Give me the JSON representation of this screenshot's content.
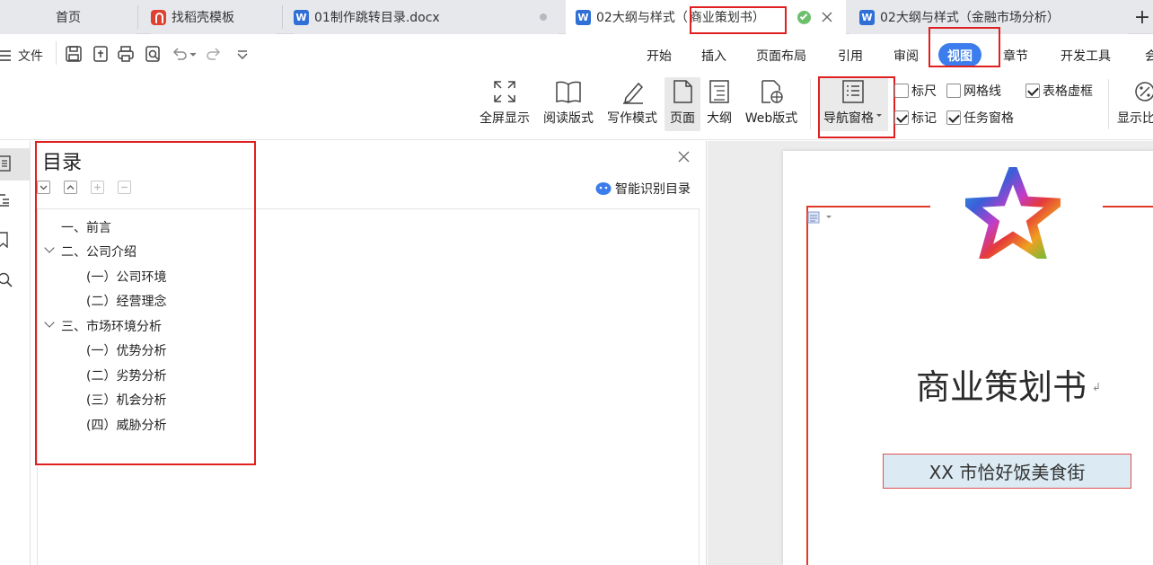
{
  "tabs": [
    {
      "label": "首页",
      "active": false
    },
    {
      "label": "找稻壳模板",
      "active": false,
      "icon": "docer-icon"
    },
    {
      "label": "01制作跳转目录.docx",
      "active": false,
      "icon": "wps-writer-icon"
    },
    {
      "label": "02大纲与样式（",
      "label_box": "商业策划书）",
      "active": true,
      "icon": "wps-writer-icon"
    },
    {
      "label": "02大纲与样式（金融市场分析）",
      "active": false,
      "icon": "wps-writer-icon"
    }
  ],
  "tab_new": "+",
  "menu": {
    "file": "文件",
    "items": [
      "开始",
      "插入",
      "页面布局",
      "引用",
      "审阅",
      "视图",
      "章节",
      "开发工具",
      "会"
    ],
    "active": "视图"
  },
  "ribbon": {
    "buttons": [
      "全屏显示",
      "阅读版式",
      "写作模式",
      "页面",
      "大纲",
      "Web版式",
      "导航窗格",
      "显示比"
    ],
    "selected": "页面",
    "checkboxes": [
      {
        "label": "标尺",
        "checked": false
      },
      {
        "label": "网格线",
        "checked": false
      },
      {
        "label": "表格虚框",
        "checked": true
      },
      {
        "label": "标记",
        "checked": true
      },
      {
        "label": "任务窗格",
        "checked": true
      }
    ]
  },
  "nav": {
    "title": "目录",
    "smart": "智能识别目录",
    "items": [
      {
        "label": "一、前言",
        "level": 1,
        "expanded": null
      },
      {
        "label": "二、公司介绍",
        "level": 1,
        "expanded": true
      },
      {
        "label": "(一）公司环境",
        "level": 2
      },
      {
        "label": "(二）经营理念",
        "level": 2
      },
      {
        "label": "三、市场环境分析",
        "level": 1,
        "expanded": true
      },
      {
        "label": "(一）优势分析",
        "level": 2
      },
      {
        "label": "(二）劣势分析",
        "level": 2
      },
      {
        "label": "(三）机会分析",
        "level": 2
      },
      {
        "label": "(四）威胁分析",
        "level": 2
      }
    ]
  },
  "document": {
    "title": "商业策划书",
    "subtitle": "XX 市恰好饭美食街"
  },
  "colors": {
    "accent": "#3b7ded",
    "highlight_border": "#e02020",
    "tabbar": "#e6e8ec"
  }
}
